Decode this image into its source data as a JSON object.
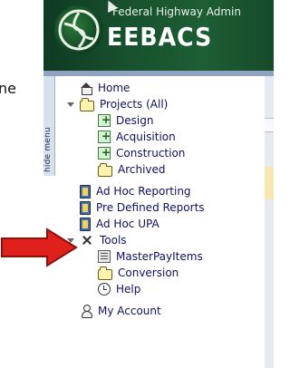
{
  "left_clip": {
    "text": "ne"
  },
  "banner": {
    "title": "Federal Highway Admin",
    "app_name": "EEBACS"
  },
  "sidebar": {
    "hide_menu_label": "hide menu",
    "items": [
      {
        "label": "Home",
        "icon": "home-icon"
      },
      {
        "label": "Projects (All)",
        "icon": "folder-icon"
      },
      {
        "label": "Design",
        "icon": "plus-box-icon"
      },
      {
        "label": "Acquisition",
        "icon": "plus-box-icon"
      },
      {
        "label": "Construction",
        "icon": "plus-box-icon"
      },
      {
        "label": "Archived",
        "icon": "folder-icon"
      },
      {
        "label": "Ad Hoc Reporting",
        "icon": "report-icon"
      },
      {
        "label": "Pre Defined Reports",
        "icon": "report-icon"
      },
      {
        "label": "Ad Hoc UPA",
        "icon": "report-icon"
      },
      {
        "label": "Tools",
        "icon": "tools-icon"
      },
      {
        "label": "MasterPayItems",
        "icon": "grid-icon"
      },
      {
        "label": "Conversion",
        "icon": "folder-icon"
      },
      {
        "label": "Help",
        "icon": "help-icon"
      },
      {
        "label": "My Account",
        "icon": "account-icon"
      }
    ]
  },
  "annotation": {
    "arrow_color": "#e0201a"
  }
}
